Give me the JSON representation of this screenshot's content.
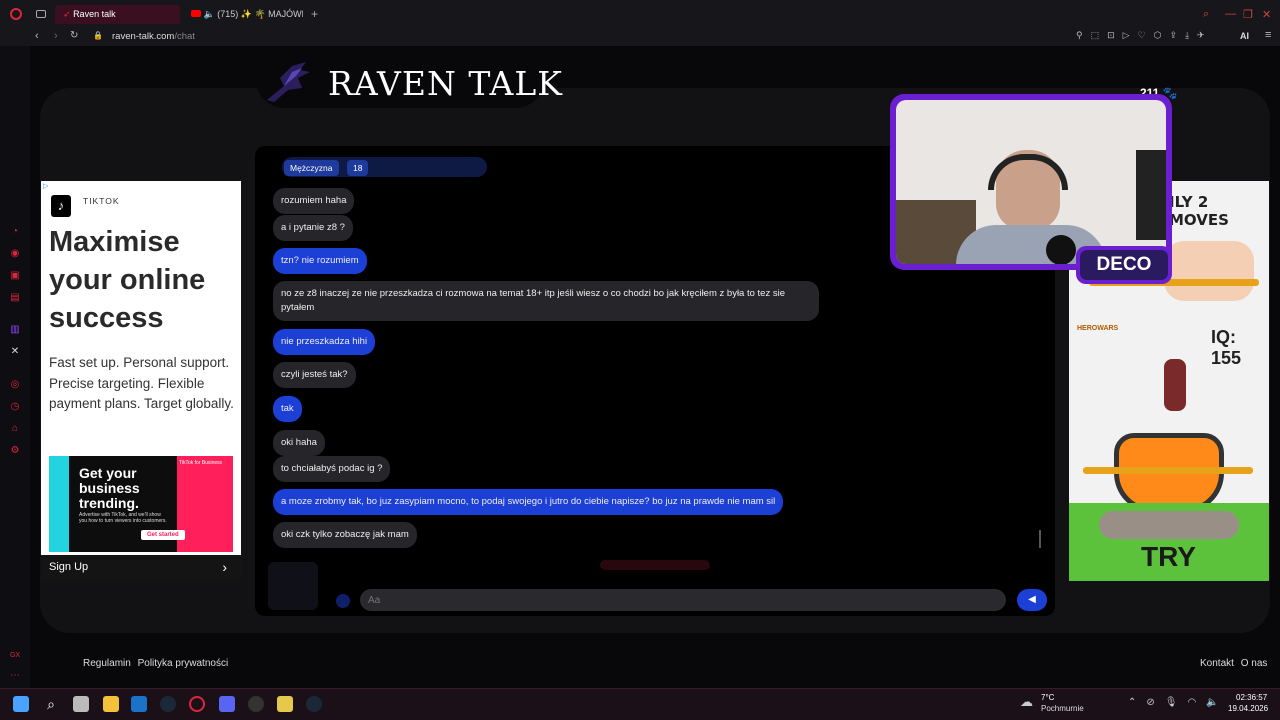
{
  "browser": {
    "tabs": [
      {
        "label": "Raven talk"
      },
      {
        "label": "(715) ✨ 🌴 MAJÓWKA"
      }
    ],
    "url_host": "raven-talk.com",
    "url_path": "/chat",
    "ai_label": "AI"
  },
  "site": {
    "brand": "RAVEN TALK",
    "online_count": "211",
    "footer_left": [
      "Regulamin",
      "Polityka prywatności"
    ],
    "footer_right": [
      "Kontakt",
      "O nas"
    ]
  },
  "chat": {
    "partner_gender": "Mężczyzna",
    "partner_age": "18",
    "messages": [
      {
        "text": "rozumiem haha",
        "side": "them"
      },
      {
        "text": "a i pytanie z8 ?",
        "side": "them"
      },
      {
        "text": "tzn? nie rozumiem",
        "side": "me"
      },
      {
        "text": "no ze z8 inaczej ze nie przeszkadza ci rozmowa na temat 18+ itp jeśli wiesz o co chodzi bo jak kręciłem z była to tez sie pytałem",
        "side": "them"
      },
      {
        "text": "nie przeszkadza hihi",
        "side": "me"
      },
      {
        "text": "czyli jesteś tak?",
        "side": "them"
      },
      {
        "text": "tak",
        "side": "me"
      },
      {
        "text": "oki haha",
        "side": "them"
      },
      {
        "text": "to chciałabyś podac ig ?",
        "side": "them"
      },
      {
        "text": "a moze zrobmy tak, bo juz zasypiam mocno, to podaj swojego i jutro do ciebie napisze? bo juz na prawde nie mam sil",
        "side": "me"
      },
      {
        "text": "oki czk tylko zobaczę jak mam",
        "side": "them"
      }
    ],
    "input_placeholder": "Aa"
  },
  "ad_left": {
    "brand": "TIKTOK",
    "headline": "Maximise your online success",
    "body": "Fast set up. Personal support. Precise targeting. Flexible payment plans. Target globally.",
    "banner_title": "Get your business trending.",
    "banner_sub": "Advertise with TikTok, and we'll show you how to turn viewers into customers.",
    "banner_cta": "Get started",
    "banner_tag": "TikTok for Business",
    "cta": "Sign Up"
  },
  "ad_right": {
    "top_text": "ILY 2 MOVES",
    "iq": "IQ: 155",
    "logo": "HEROWARS",
    "cta": "TRY"
  },
  "webcam": {
    "name": "DECO"
  },
  "taskbar": {
    "weather_temp": "7°C",
    "weather_desc": "Pochmurnie",
    "time": "02:36:57",
    "date": "19.04.2026"
  },
  "colors": {
    "accent_blue": "#1c3fd6",
    "bubble_gray": "#26262a",
    "brand_red": "#c8102e",
    "cam_purple": "#6a1fd0"
  }
}
